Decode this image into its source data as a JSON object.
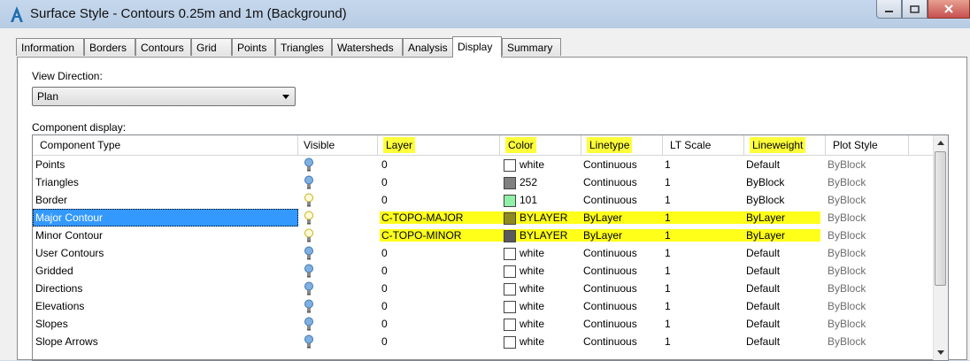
{
  "window": {
    "title": "Surface Style - Contours 0.25m and 1m (Background)"
  },
  "tabs": [
    "Information",
    "Borders",
    "Contours",
    "Grid",
    "Points",
    "Triangles",
    "Watersheds",
    "Analysis",
    "Display",
    "Summary"
  ],
  "active_tab": "Display",
  "view_direction": {
    "label": "View Direction:",
    "value": "Plan"
  },
  "component_display": {
    "label": "Component display:",
    "columns": [
      "Component Type",
      "Visible",
      "Layer",
      "Color",
      "Linetype",
      "LT Scale",
      "Lineweight",
      "Plot Style"
    ],
    "rows": [
      {
        "type": "Points",
        "layer": "0",
        "color": "white",
        "color_hex": "#ffffff",
        "linetype": "Continuous",
        "lt_scale": "1",
        "lineweight": "Default",
        "plot_style": "ByBlock",
        "bulb": "on-blue"
      },
      {
        "type": "Triangles",
        "layer": "0",
        "color": "252",
        "color_hex": "#808080",
        "linetype": "Continuous",
        "lt_scale": "1",
        "lineweight": "ByBlock",
        "plot_style": "ByBlock",
        "bulb": "on-blue"
      },
      {
        "type": "Border",
        "layer": "0",
        "color": "101",
        "color_hex": "#8ff0a8",
        "linetype": "Continuous",
        "lt_scale": "1",
        "lineweight": "ByBlock",
        "plot_style": "ByBlock",
        "bulb": "off-yellow"
      },
      {
        "type": "Major Contour",
        "layer": "C-TOPO-MAJOR",
        "color": "BYLAYER",
        "color_hex": "#8f8a1f",
        "linetype": "ByLayer",
        "lt_scale": "1",
        "lineweight": "ByLayer",
        "plot_style": "ByBlock",
        "bulb": "off-yellow"
      },
      {
        "type": "Minor Contour",
        "layer": "C-TOPO-MINOR",
        "color": "BYLAYER",
        "color_hex": "#5a5a5a",
        "linetype": "ByLayer",
        "lt_scale": "1",
        "lineweight": "ByLayer",
        "plot_style": "ByBlock",
        "bulb": "off-yellow"
      },
      {
        "type": "User Contours",
        "layer": "0",
        "color": "white",
        "color_hex": "#ffffff",
        "linetype": "Continuous",
        "lt_scale": "1",
        "lineweight": "Default",
        "plot_style": "ByBlock",
        "bulb": "on-blue"
      },
      {
        "type": "Gridded",
        "layer": "0",
        "color": "white",
        "color_hex": "#ffffff",
        "linetype": "Continuous",
        "lt_scale": "1",
        "lineweight": "Default",
        "plot_style": "ByBlock",
        "bulb": "on-blue"
      },
      {
        "type": "Directions",
        "layer": "0",
        "color": "white",
        "color_hex": "#ffffff",
        "linetype": "Continuous",
        "lt_scale": "1",
        "lineweight": "Default",
        "plot_style": "ByBlock",
        "bulb": "on-blue"
      },
      {
        "type": "Elevations",
        "layer": "0",
        "color": "white",
        "color_hex": "#ffffff",
        "linetype": "Continuous",
        "lt_scale": "1",
        "lineweight": "Default",
        "plot_style": "ByBlock",
        "bulb": "on-blue"
      },
      {
        "type": "Slopes",
        "layer": "0",
        "color": "white",
        "color_hex": "#ffffff",
        "linetype": "Continuous",
        "lt_scale": "1",
        "lineweight": "Default",
        "plot_style": "ByBlock",
        "bulb": "on-blue"
      },
      {
        "type": "Slope Arrows",
        "layer": "0",
        "color": "white",
        "color_hex": "#ffffff",
        "linetype": "Continuous",
        "lt_scale": "1",
        "lineweight": "Default",
        "plot_style": "ByBlock",
        "bulb": "on-blue"
      }
    ],
    "selected_row": "Major Contour"
  },
  "colors": {
    "highlight": "#ffff00",
    "selection": "#3399ff",
    "title_bar": "#bcd0e7"
  }
}
